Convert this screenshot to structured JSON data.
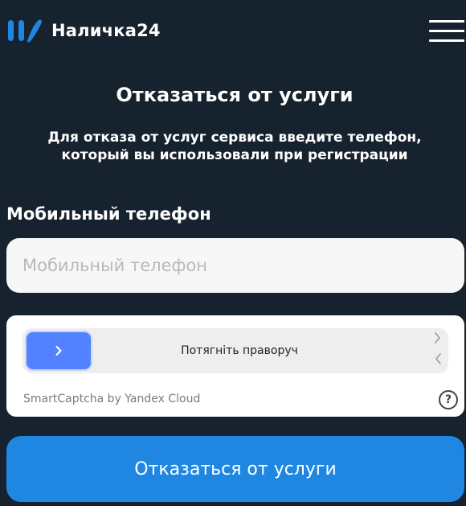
{
  "colors": {
    "background": "#16222e",
    "accent": "#1f87e2",
    "logo_blue": "#1f87e2",
    "slider_handle": "#5282ff",
    "input_background": "#f7f7f7"
  },
  "header": {
    "logo_icon": "nalichka-logo-icon",
    "brand_name": "Наличка24",
    "menu_icon": "hamburger-menu-icon"
  },
  "main": {
    "title": "Отказаться от услуги",
    "description": "Для отказа от услуг сервиса введите телефон, который вы использовали при регистрации"
  },
  "phone_field": {
    "label": "Мобильный телефон",
    "placeholder": "Мобильный телефон",
    "value": ""
  },
  "captcha": {
    "slider_text": "Потягніть праворуч",
    "handle_icon": "chevron-right-icon",
    "hint_icon": "slide-arrows-icon",
    "brand": "SmartCaptcha by Yandex Cloud",
    "help_icon": "question-circle-icon",
    "help_glyph": "?"
  },
  "submit": {
    "label": "Отказаться от услуги"
  }
}
